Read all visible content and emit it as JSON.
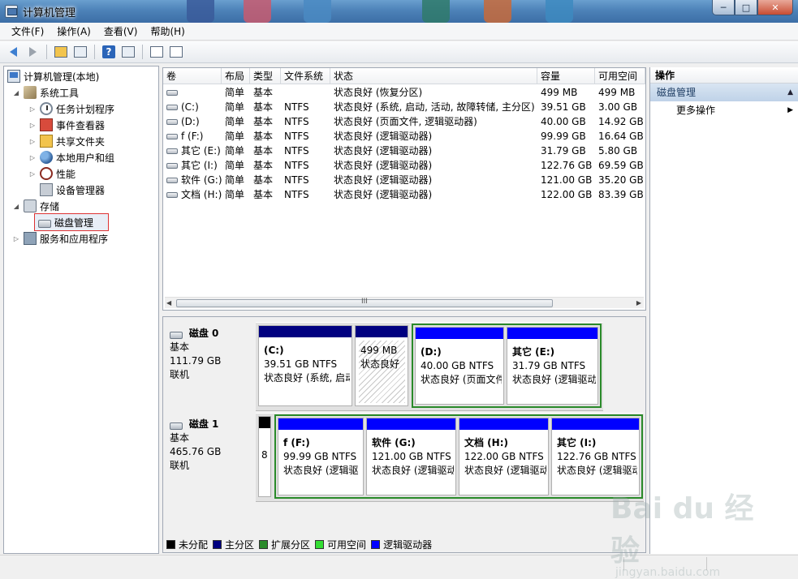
{
  "window": {
    "title": "计算机管理",
    "min": "─",
    "max": "□",
    "close": "✕"
  },
  "menu": [
    "文件(F)",
    "操作(A)",
    "查看(V)",
    "帮助(H)"
  ],
  "tree": [
    {
      "label": "计算机管理(本地)",
      "level": 0,
      "expander": "",
      "icon": "computer-icon"
    },
    {
      "label": "系统工具",
      "level": 1,
      "expander": "◢",
      "icon": "tools-icon"
    },
    {
      "label": "任务计划程序",
      "level": 2,
      "expander": "▷",
      "icon": "clock-icon"
    },
    {
      "label": "事件查看器",
      "level": 2,
      "expander": "▷",
      "icon": "events-icon"
    },
    {
      "label": "共享文件夹",
      "level": 2,
      "expander": "▷",
      "icon": "share-icon"
    },
    {
      "label": "本地用户和组",
      "level": 2,
      "expander": "▷",
      "icon": "users-icon"
    },
    {
      "label": "性能",
      "level": 2,
      "expander": "▷",
      "icon": "performance-icon"
    },
    {
      "label": "设备管理器",
      "level": 2,
      "expander": "",
      "icon": "device-manager-icon"
    },
    {
      "label": "存储",
      "level": 1,
      "expander": "◢",
      "icon": "storage-icon"
    },
    {
      "label": "磁盘管理",
      "level": 2,
      "expander": "",
      "icon": "disk-icon",
      "selected": true
    },
    {
      "label": "服务和应用程序",
      "level": 1,
      "expander": "▷",
      "icon": "services-icon"
    }
  ],
  "volumes": {
    "headers": [
      "卷",
      "布局",
      "类型",
      "文件系统",
      "状态",
      "容量",
      "可用空间"
    ],
    "rows": [
      [
        "",
        "简单",
        "基本",
        "",
        "状态良好 (恢复分区)",
        "499 MB",
        "499 MB"
      ],
      [
        "(C:)",
        "简单",
        "基本",
        "NTFS",
        "状态良好 (系统, 启动, 活动, 故障转储, 主分区)",
        "39.51 GB",
        "3.00 GB"
      ],
      [
        "(D:)",
        "简单",
        "基本",
        "NTFS",
        "状态良好 (页面文件, 逻辑驱动器)",
        "40.00 GB",
        "14.92 GB"
      ],
      [
        "f (F:)",
        "简单",
        "基本",
        "NTFS",
        "状态良好 (逻辑驱动器)",
        "99.99 GB",
        "16.64 GB"
      ],
      [
        "其它 (E:)",
        "简单",
        "基本",
        "NTFS",
        "状态良好 (逻辑驱动器)",
        "31.79 GB",
        "5.80 GB"
      ],
      [
        "其它 (I:)",
        "简单",
        "基本",
        "NTFS",
        "状态良好 (逻辑驱动器)",
        "122.76 GB",
        "69.59 GB"
      ],
      [
        "软件 (G:)",
        "简单",
        "基本",
        "NTFS",
        "状态良好 (逻辑驱动器)",
        "121.00 GB",
        "35.20 GB"
      ],
      [
        "文档 (H:)",
        "简单",
        "基本",
        "NTFS",
        "状态良好 (逻辑驱动器)",
        "122.00 GB",
        "83.39 GB"
      ]
    ],
    "scroll_grip": "III"
  },
  "disks": [
    {
      "name": "磁盘 0",
      "type": "基本",
      "size": "111.79 GB",
      "status": "联机",
      "partitions": [
        {
          "name": "(C:)",
          "size": "39.51 GB NTFS",
          "status": "状态良好 (系统, 启动",
          "kind": "primary"
        },
        {
          "name": "",
          "size": "499 MB",
          "status": "状态良好",
          "kind": "primary-hatched"
        },
        {
          "name": "(D:)",
          "size": "40.00 GB NTFS",
          "status": "状态良好 (页面文件",
          "kind": "logical"
        },
        {
          "name": "其它  (E:)",
          "size": "31.79 GB NTFS",
          "status": "状态良好 (逻辑驱动",
          "kind": "logical"
        }
      ]
    },
    {
      "name": "磁盘 1",
      "type": "基本",
      "size": "465.76 GB",
      "status": "联机",
      "partitions": [
        {
          "name": "",
          "size": "",
          "status": "8",
          "kind": "unallocated"
        },
        {
          "name": "f  (F:)",
          "size": "99.99 GB NTFS",
          "status": "状态良好 (逻辑驱",
          "kind": "logical"
        },
        {
          "name": "软件  (G:)",
          "size": "121.00 GB NTFS",
          "status": "状态良好 (逻辑驱动",
          "kind": "logical"
        },
        {
          "name": "文档  (H:)",
          "size": "122.00 GB NTFS",
          "status": "状态良好 (逻辑驱动",
          "kind": "logical"
        },
        {
          "name": "其它  (I:)",
          "size": "122.76 GB NTFS",
          "status": "状态良好 (逻辑驱动",
          "kind": "logical"
        }
      ]
    }
  ],
  "legend": [
    {
      "label": "未分配",
      "color": "#000000"
    },
    {
      "label": "主分区",
      "color": "#000080"
    },
    {
      "label": "扩展分区",
      "color": "#2a8a2a"
    },
    {
      "label": "可用空间",
      "color": "#33dd33"
    },
    {
      "label": "逻辑驱动器",
      "color": "#0000ff"
    }
  ],
  "actions": {
    "header": "操作",
    "group": "磁盘管理",
    "items": [
      "更多操作"
    ]
  },
  "watermark": {
    "brand": "Bai du 经验",
    "url": "jingyan.baidu.com"
  },
  "colors": {
    "primary_bar": "#000080",
    "logical_bar": "#0000ff",
    "extended_frame": "#2a8a2a",
    "unallocated_bar": "#000000"
  }
}
